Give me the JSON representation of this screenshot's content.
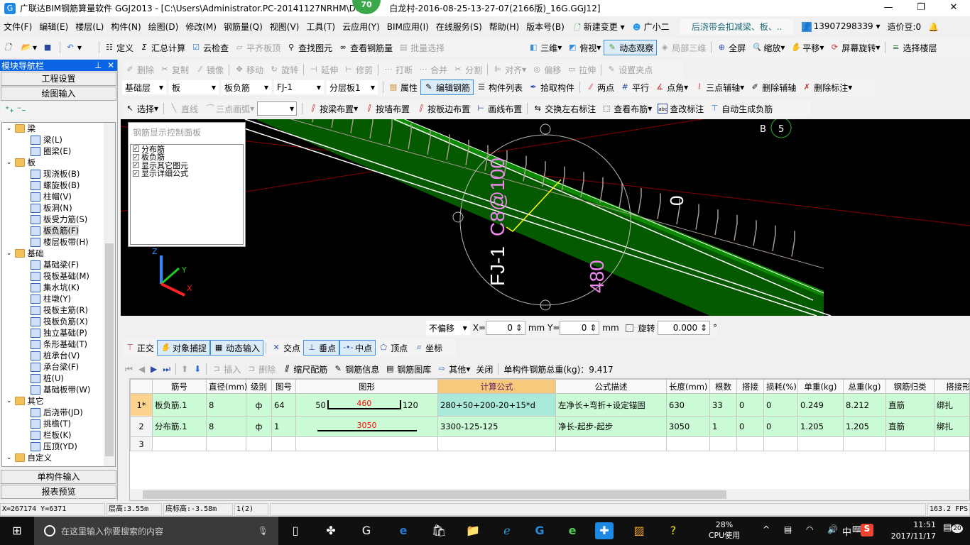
{
  "title": {
    "text": "广联达BIM钢筋算量软件 GGJ2013 - [C:\\Users\\Administrator.PC-20141127NRHM\\De",
    "text2": "白龙村-2016-08-25-13-27-07(2166版)_16G.GGJ12]",
    "badge": "70"
  },
  "menu": [
    "文件(F)",
    "编辑(E)",
    "楼层(L)",
    "构件(N)",
    "绘图(D)",
    "修改(M)",
    "钢筋量(Q)",
    "视图(V)",
    "工具(T)",
    "云应用(Y)",
    "BIM应用(I)",
    "在线服务(S)",
    "帮助(H)",
    "版本号(B)"
  ],
  "menu_right": {
    "new_change": "新建变更",
    "assistant": "广小二",
    "news": "后浇带会扣减梁、板、..",
    "account": "13907298339",
    "beans": "造价豆:0"
  },
  "toolbar1": [
    "定义",
    "汇总计算",
    "云检查",
    "平齐板顶",
    "查找图元",
    "查看钢筋量",
    "批量选择",
    "三维",
    "俯视",
    "动态观察",
    "局部三维",
    "全屏",
    "缩放",
    "平移",
    "屏幕旋转",
    "选择楼层"
  ],
  "toolbar_edit": [
    "删除",
    "复制",
    "镜像",
    "移动",
    "旋转",
    "延伸",
    "修剪",
    "打断",
    "合并",
    "分割",
    "对齐",
    "偏移",
    "拉伸",
    "设置夹点"
  ],
  "selectors": {
    "floor": "基础层",
    "type": "板",
    "subtype": "板负筋",
    "name": "FJ-1",
    "layer": "分层板1"
  },
  "toolbar_comp": [
    "属性",
    "编辑钢筋",
    "构件列表",
    "拾取构件",
    "两点",
    "平行",
    "点角",
    "三点辅轴",
    "删除辅轴",
    "删除标注"
  ],
  "toolbar_draw": {
    "select": "选择",
    "line": "直线",
    "arc": "三点画弧",
    "items": [
      "按梁布置",
      "按墙布置",
      "按板边布置",
      "画线布置",
      "交换左右标注",
      "查看布筋",
      "查改标注",
      "自动生成负筋"
    ]
  },
  "nav": {
    "header": "模块导航栏",
    "top_buttons": [
      "工程设置",
      "绘图输入"
    ],
    "bottom_buttons": [
      "单构件输入",
      "报表预览"
    ],
    "tree": [
      {
        "label": "梁",
        "folder": true
      },
      {
        "label": "梁(L)"
      },
      {
        "label": "圈梁(E)"
      },
      {
        "label": "板",
        "folder": true
      },
      {
        "label": "现浇板(B)"
      },
      {
        "label": "螺旋板(B)"
      },
      {
        "label": "柱帽(V)"
      },
      {
        "label": "板洞(N)"
      },
      {
        "label": "板受力筋(S)"
      },
      {
        "label": "板负筋(F)",
        "selected": true
      },
      {
        "label": "楼层板带(H)"
      },
      {
        "label": "基础",
        "folder": true
      },
      {
        "label": "基础梁(F)"
      },
      {
        "label": "筏板基础(M)"
      },
      {
        "label": "集水坑(K)"
      },
      {
        "label": "柱墩(Y)"
      },
      {
        "label": "筏板主筋(R)"
      },
      {
        "label": "筏板负筋(X)"
      },
      {
        "label": "独立基础(P)"
      },
      {
        "label": "条形基础(T)"
      },
      {
        "label": "桩承台(V)"
      },
      {
        "label": "承台梁(F)"
      },
      {
        "label": "桩(U)"
      },
      {
        "label": "基础板带(W)"
      },
      {
        "label": "其它",
        "folder": true
      },
      {
        "label": "后浇带(JD)"
      },
      {
        "label": "挑檐(T)"
      },
      {
        "label": "栏板(K)"
      },
      {
        "label": "压顶(YD)"
      },
      {
        "label": "自定义",
        "folder": true
      }
    ]
  },
  "panel": {
    "title": "钢筋显示控制面板",
    "items": [
      "分布筋",
      "板负筋",
      "显示其它图元",
      "显示详细公式"
    ]
  },
  "viewport": {
    "label1": "FJ-1",
    "label2": "C8@100",
    "label3": "480",
    "label4": "0",
    "axis": "B",
    "axis2": "5",
    "x": "X",
    "y": "Y",
    "z": "Z"
  },
  "coordbar": {
    "mode": "不偏移",
    "x_label": "X=",
    "x": "0",
    "y_label": "Y=",
    "y": "0",
    "unit": "mm",
    "rotate": "旋转",
    "rotate_val": "0.000",
    "deg": "°"
  },
  "snapbar": [
    "正交",
    "对象捕捉",
    "动态输入",
    "交点",
    "垂点",
    "中点",
    "顶点",
    "坐标"
  ],
  "rebar_toolbar": {
    "items": [
      "插入",
      "删除",
      "缩尺配筋",
      "钢筋信息",
      "钢筋图库",
      "其他",
      "关闭"
    ],
    "total": "单构件钢筋总重(kg)：9.417"
  },
  "table": {
    "headers": [
      "",
      "筋号",
      "直径(mm)",
      "级别",
      "图号",
      "图形",
      "计算公式",
      "公式描述",
      "长度(mm)",
      "根数",
      "搭接",
      "损耗(%)",
      "单重(kg)",
      "总重(kg)",
      "钢筋归类",
      "搭接形"
    ],
    "rows": [
      {
        "no": "1*",
        "name": "板负筋.1",
        "dia": "8",
        "grade": "ф",
        "fig": "64",
        "shape_left": "50",
        "shape_mid": "460",
        "shape_right": "120",
        "formula": "280+50+200-20+15*d",
        "desc": "左净长+弯折+设定锚固",
        "len": "630",
        "count": "33",
        "lap": "0",
        "loss": "0",
        "unit_w": "0.249",
        "total_w": "8.212",
        "cat": "直筋",
        "lap_type": "绑扎"
      },
      {
        "no": "2",
        "name": "分布筋.1",
        "dia": "8",
        "grade": "ф",
        "fig": "1",
        "shape_mid": "3050",
        "formula": "3300-125-125",
        "desc": "净长-起步-起步",
        "len": "3050",
        "count": "1",
        "lap": "0",
        "loss": "0",
        "unit_w": "1.205",
        "total_w": "1.205",
        "cat": "直筋",
        "lap_type": "绑扎"
      },
      {
        "no": "3"
      }
    ]
  },
  "status": {
    "coords": "X=267174 Y=6371",
    "floor_h": "层高:3.55m",
    "base_h": "底标高:-3.58m",
    "count": "1(2)",
    "fps": "163.2 FPS"
  },
  "taskbar": {
    "search": "在这里输入你要搜索的内容",
    "cpu": "28%",
    "cpu_label": "CPU使用",
    "ime": "中",
    "time": "11:51",
    "date": "2017/11/17",
    "notif": "20"
  },
  "colors": {
    "nav_header": "#0a64e4",
    "grid_row": "#ccfcd6",
    "formula_header": "#f7c97a",
    "slab": "#0a6a00",
    "viewport": "#000000"
  }
}
